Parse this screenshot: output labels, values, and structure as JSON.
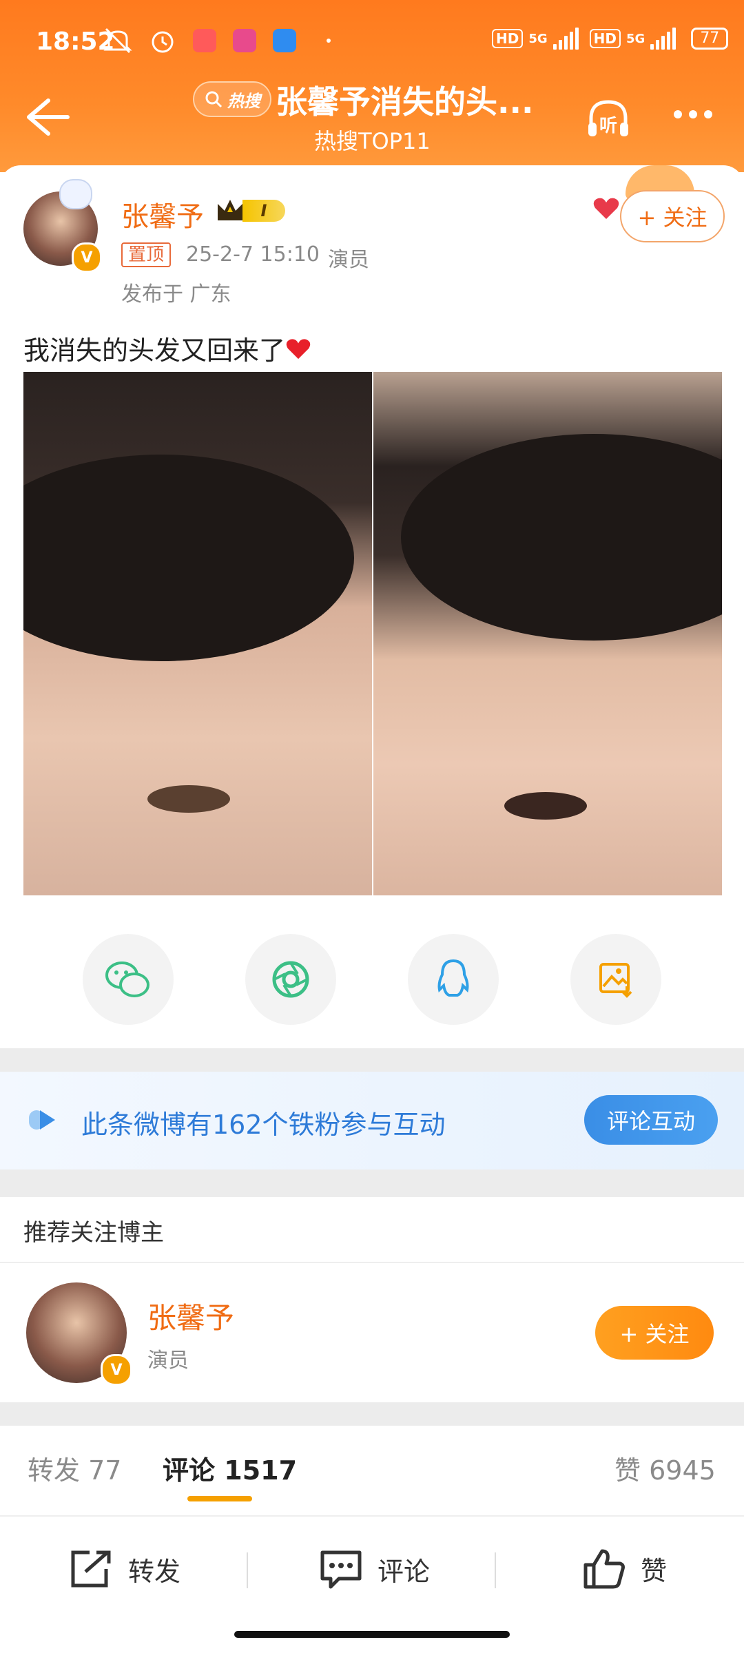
{
  "status_bar": {
    "time": "18:52",
    "network1": "5G",
    "network2": "5G",
    "hd1": "HD",
    "hd2": "HD",
    "battery": "77"
  },
  "header": {
    "badge": "热搜",
    "title": "张馨予消失的头...",
    "subtitle": "热搜TOP11",
    "listen_label": "听"
  },
  "post": {
    "author": "张馨予",
    "level_badge": "I",
    "pinned": "置顶",
    "time": "25-2-7 15:10",
    "role": "演员",
    "location": "发布于 广东",
    "text": "我消失的头发又回来了",
    "follow_label": "+ 关注"
  },
  "share": {
    "items": [
      "wechat-icon",
      "moments-icon",
      "qq-icon",
      "save-image-icon"
    ]
  },
  "fans_banner": {
    "text": "此条微博有162个铁粉参与互动",
    "button": "评论互动"
  },
  "recommend": {
    "title": "推荐关注博主",
    "name": "张馨予",
    "role": "演员",
    "follow_label": "+ 关注"
  },
  "tabs": {
    "repost_label": "转发",
    "repost_count": "77",
    "comment_label": "评论",
    "comment_count": "1517",
    "like_label": "赞",
    "like_count": "6945"
  },
  "bottom_bar": {
    "repost": "转发",
    "comment": "评论",
    "like": "赞"
  },
  "colors": {
    "accent": "#f06c14",
    "header": "#ff7a1e",
    "blue": "#3a8ee6"
  }
}
